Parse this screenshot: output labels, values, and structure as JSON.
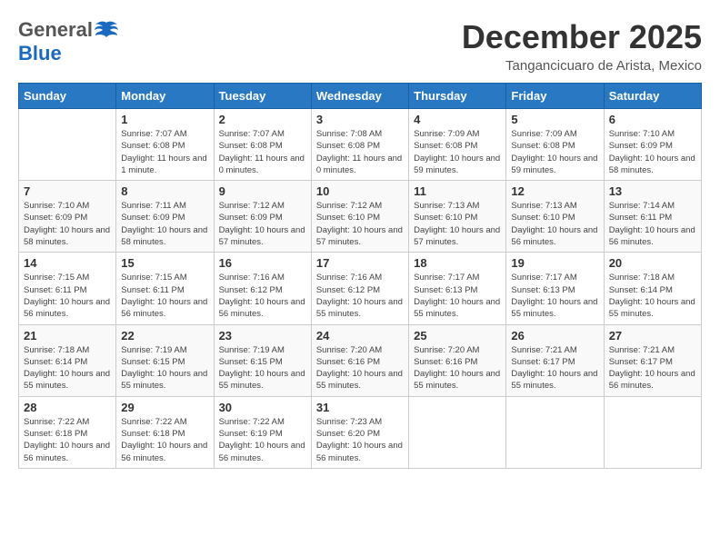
{
  "logo": {
    "general": "General",
    "blue": "Blue"
  },
  "title": "December 2025",
  "location": "Tangancicuaro de Arista, Mexico",
  "days_header": [
    "Sunday",
    "Monday",
    "Tuesday",
    "Wednesday",
    "Thursday",
    "Friday",
    "Saturday"
  ],
  "weeks": [
    [
      {
        "day": "",
        "sunrise": "",
        "sunset": "",
        "daylight": ""
      },
      {
        "day": "1",
        "sunrise": "Sunrise: 7:07 AM",
        "sunset": "Sunset: 6:08 PM",
        "daylight": "Daylight: 11 hours and 1 minute."
      },
      {
        "day": "2",
        "sunrise": "Sunrise: 7:07 AM",
        "sunset": "Sunset: 6:08 PM",
        "daylight": "Daylight: 11 hours and 0 minutes."
      },
      {
        "day": "3",
        "sunrise": "Sunrise: 7:08 AM",
        "sunset": "Sunset: 6:08 PM",
        "daylight": "Daylight: 11 hours and 0 minutes."
      },
      {
        "day": "4",
        "sunrise": "Sunrise: 7:09 AM",
        "sunset": "Sunset: 6:08 PM",
        "daylight": "Daylight: 10 hours and 59 minutes."
      },
      {
        "day": "5",
        "sunrise": "Sunrise: 7:09 AM",
        "sunset": "Sunset: 6:08 PM",
        "daylight": "Daylight: 10 hours and 59 minutes."
      },
      {
        "day": "6",
        "sunrise": "Sunrise: 7:10 AM",
        "sunset": "Sunset: 6:09 PM",
        "daylight": "Daylight: 10 hours and 58 minutes."
      }
    ],
    [
      {
        "day": "7",
        "sunrise": "Sunrise: 7:10 AM",
        "sunset": "Sunset: 6:09 PM",
        "daylight": "Daylight: 10 hours and 58 minutes."
      },
      {
        "day": "8",
        "sunrise": "Sunrise: 7:11 AM",
        "sunset": "Sunset: 6:09 PM",
        "daylight": "Daylight: 10 hours and 58 minutes."
      },
      {
        "day": "9",
        "sunrise": "Sunrise: 7:12 AM",
        "sunset": "Sunset: 6:09 PM",
        "daylight": "Daylight: 10 hours and 57 minutes."
      },
      {
        "day": "10",
        "sunrise": "Sunrise: 7:12 AM",
        "sunset": "Sunset: 6:10 PM",
        "daylight": "Daylight: 10 hours and 57 minutes."
      },
      {
        "day": "11",
        "sunrise": "Sunrise: 7:13 AM",
        "sunset": "Sunset: 6:10 PM",
        "daylight": "Daylight: 10 hours and 57 minutes."
      },
      {
        "day": "12",
        "sunrise": "Sunrise: 7:13 AM",
        "sunset": "Sunset: 6:10 PM",
        "daylight": "Daylight: 10 hours and 56 minutes."
      },
      {
        "day": "13",
        "sunrise": "Sunrise: 7:14 AM",
        "sunset": "Sunset: 6:11 PM",
        "daylight": "Daylight: 10 hours and 56 minutes."
      }
    ],
    [
      {
        "day": "14",
        "sunrise": "Sunrise: 7:15 AM",
        "sunset": "Sunset: 6:11 PM",
        "daylight": "Daylight: 10 hours and 56 minutes."
      },
      {
        "day": "15",
        "sunrise": "Sunrise: 7:15 AM",
        "sunset": "Sunset: 6:11 PM",
        "daylight": "Daylight: 10 hours and 56 minutes."
      },
      {
        "day": "16",
        "sunrise": "Sunrise: 7:16 AM",
        "sunset": "Sunset: 6:12 PM",
        "daylight": "Daylight: 10 hours and 56 minutes."
      },
      {
        "day": "17",
        "sunrise": "Sunrise: 7:16 AM",
        "sunset": "Sunset: 6:12 PM",
        "daylight": "Daylight: 10 hours and 55 minutes."
      },
      {
        "day": "18",
        "sunrise": "Sunrise: 7:17 AM",
        "sunset": "Sunset: 6:13 PM",
        "daylight": "Daylight: 10 hours and 55 minutes."
      },
      {
        "day": "19",
        "sunrise": "Sunrise: 7:17 AM",
        "sunset": "Sunset: 6:13 PM",
        "daylight": "Daylight: 10 hours and 55 minutes."
      },
      {
        "day": "20",
        "sunrise": "Sunrise: 7:18 AM",
        "sunset": "Sunset: 6:14 PM",
        "daylight": "Daylight: 10 hours and 55 minutes."
      }
    ],
    [
      {
        "day": "21",
        "sunrise": "Sunrise: 7:18 AM",
        "sunset": "Sunset: 6:14 PM",
        "daylight": "Daylight: 10 hours and 55 minutes."
      },
      {
        "day": "22",
        "sunrise": "Sunrise: 7:19 AM",
        "sunset": "Sunset: 6:15 PM",
        "daylight": "Daylight: 10 hours and 55 minutes."
      },
      {
        "day": "23",
        "sunrise": "Sunrise: 7:19 AM",
        "sunset": "Sunset: 6:15 PM",
        "daylight": "Daylight: 10 hours and 55 minutes."
      },
      {
        "day": "24",
        "sunrise": "Sunrise: 7:20 AM",
        "sunset": "Sunset: 6:16 PM",
        "daylight": "Daylight: 10 hours and 55 minutes."
      },
      {
        "day": "25",
        "sunrise": "Sunrise: 7:20 AM",
        "sunset": "Sunset: 6:16 PM",
        "daylight": "Daylight: 10 hours and 55 minutes."
      },
      {
        "day": "26",
        "sunrise": "Sunrise: 7:21 AM",
        "sunset": "Sunset: 6:17 PM",
        "daylight": "Daylight: 10 hours and 55 minutes."
      },
      {
        "day": "27",
        "sunrise": "Sunrise: 7:21 AM",
        "sunset": "Sunset: 6:17 PM",
        "daylight": "Daylight: 10 hours and 56 minutes."
      }
    ],
    [
      {
        "day": "28",
        "sunrise": "Sunrise: 7:22 AM",
        "sunset": "Sunset: 6:18 PM",
        "daylight": "Daylight: 10 hours and 56 minutes."
      },
      {
        "day": "29",
        "sunrise": "Sunrise: 7:22 AM",
        "sunset": "Sunset: 6:18 PM",
        "daylight": "Daylight: 10 hours and 56 minutes."
      },
      {
        "day": "30",
        "sunrise": "Sunrise: 7:22 AM",
        "sunset": "Sunset: 6:19 PM",
        "daylight": "Daylight: 10 hours and 56 minutes."
      },
      {
        "day": "31",
        "sunrise": "Sunrise: 7:23 AM",
        "sunset": "Sunset: 6:20 PM",
        "daylight": "Daylight: 10 hours and 56 minutes."
      },
      {
        "day": "",
        "sunrise": "",
        "sunset": "",
        "daylight": ""
      },
      {
        "day": "",
        "sunrise": "",
        "sunset": "",
        "daylight": ""
      },
      {
        "day": "",
        "sunrise": "",
        "sunset": "",
        "daylight": ""
      }
    ]
  ]
}
